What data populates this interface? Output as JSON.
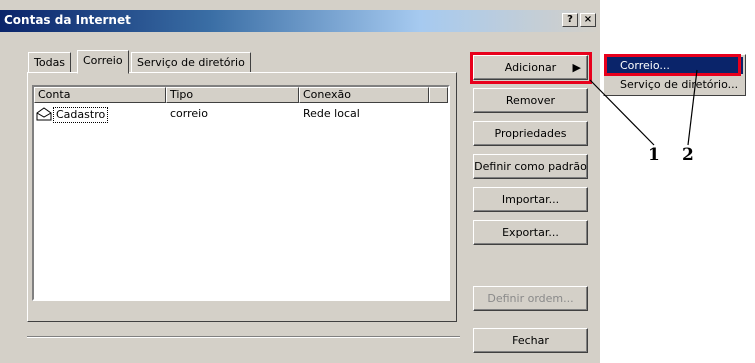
{
  "window": {
    "title": "Contas da Internet",
    "help_button": "?",
    "close_button": "×"
  },
  "tabs": [
    {
      "label": "Todas"
    },
    {
      "label": "Correio"
    },
    {
      "label": "Serviço de diretório"
    }
  ],
  "list": {
    "columns": [
      "Conta",
      "Tipo",
      "Conexão"
    ],
    "rows": [
      {
        "account": "Cadastro",
        "type": "correio",
        "connection": "Rede local",
        "icon": "mail-account-icon"
      }
    ]
  },
  "buttons": {
    "add": "Adicionar",
    "remove": "Remover",
    "properties": "Propriedades",
    "set_default": "Definir como padrão",
    "import": "Importar...",
    "export": "Exportar...",
    "set_order": "Definir ordem...",
    "close": "Fechar"
  },
  "add_menu": {
    "items": [
      "Correio...",
      "Serviço de diretório..."
    ],
    "selected": "Correio..."
  },
  "callouts": [
    "1",
    "2"
  ],
  "colors": {
    "title_bar": "#0a246a",
    "window_bg": "#d4d0c8",
    "highlight": "#e8001c",
    "selection": "#0a246a"
  }
}
